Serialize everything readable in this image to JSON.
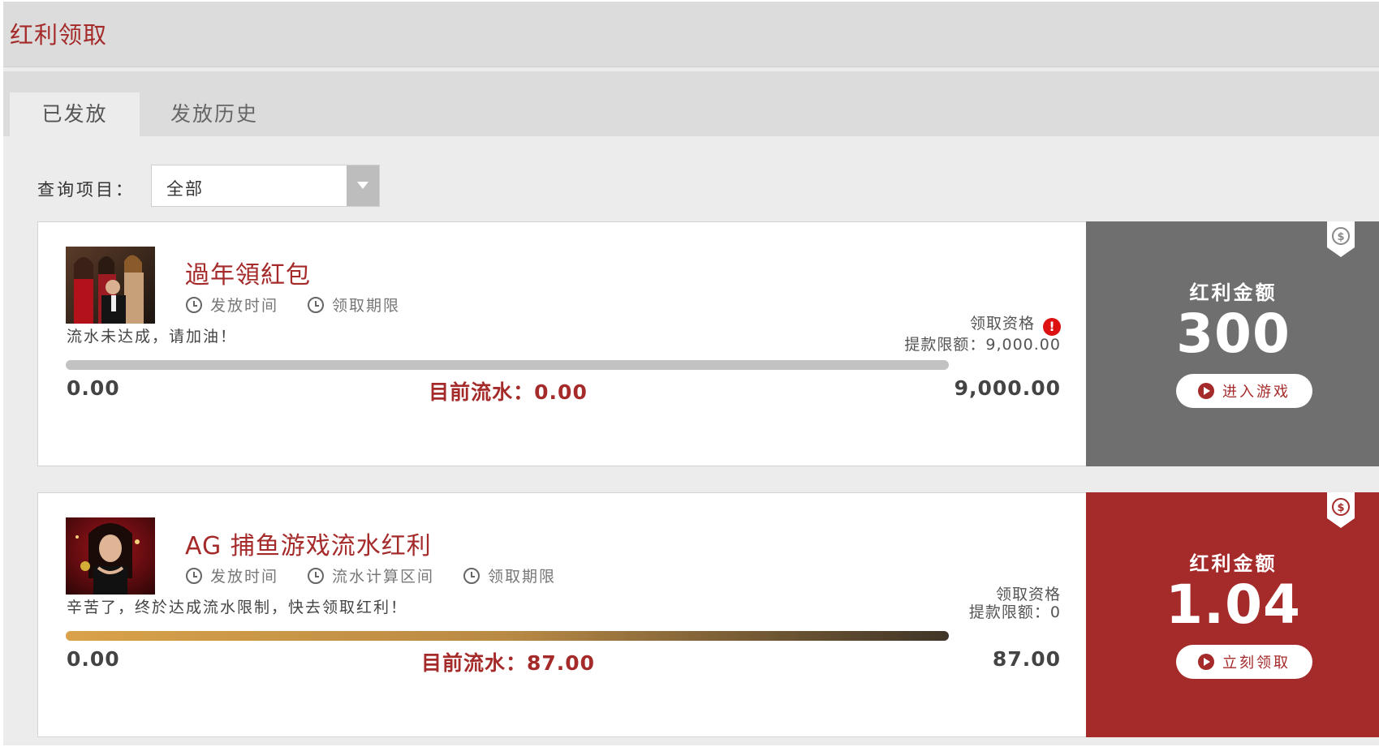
{
  "page": {
    "title": "红利领取"
  },
  "tabs": [
    {
      "label": "已发放",
      "active": true
    },
    {
      "label": "发放历史",
      "active": false
    }
  ],
  "filter": {
    "label": "查询项目：",
    "selected": "全部"
  },
  "colors": {
    "accent": "#a52a2a",
    "panel_gray": "#6f6f6f",
    "panel_red": "#a52a2a",
    "progress_gold_start": "#d9a24a",
    "progress_gold_end": "#3f3427"
  },
  "bonuses": [
    {
      "title": "過年領紅包",
      "meta": [
        "发放时间",
        "领取期限"
      ],
      "message": "流水未达成，请加油！",
      "eligibility_label": "领取资格",
      "eligibility_warning_icon": "exclamation-circle-icon",
      "withdraw_limit": "提款限额：9,000.00",
      "progress_min": "0.00",
      "progress_current": "目前流水：0.00",
      "progress_max": "9,000.00",
      "progress_fraction": 0,
      "panel": {
        "label": "红利金额",
        "amount": "300",
        "button": "进入游戏",
        "color": "#6f6f6f"
      }
    },
    {
      "title": "AG 捕鱼游戏流水红利",
      "meta": [
        "发放时间",
        "流水计算区间",
        "领取期限"
      ],
      "message": "辛苦了，终於达成流水限制，快去领取红利！",
      "eligibility_label": "领取资格",
      "withdraw_limit": "提款限额：0",
      "progress_min": "0.00",
      "progress_current": "目前流水：87.00",
      "progress_max": "87.00",
      "progress_fraction": 1,
      "panel": {
        "label": "红利金额",
        "amount": "1.04",
        "button": "立刻领取",
        "color": "#a52a2a"
      }
    }
  ]
}
